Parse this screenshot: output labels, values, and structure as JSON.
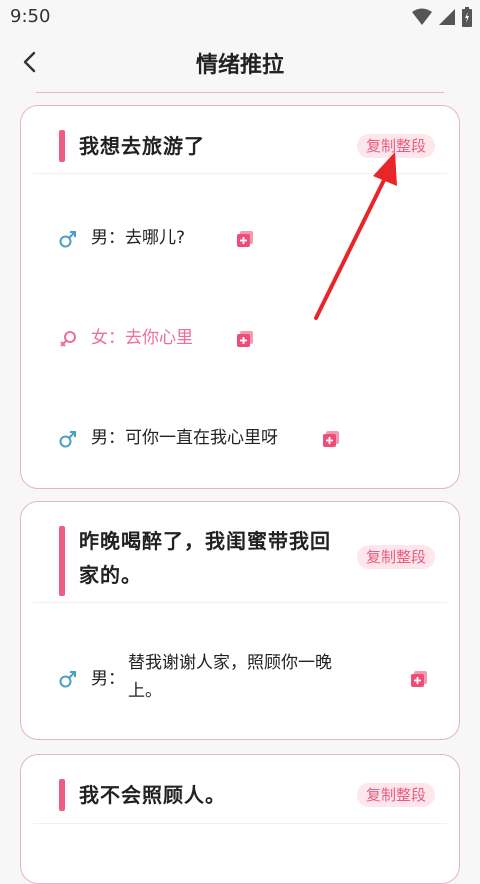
{
  "status_bar": {
    "time": "9:50",
    "icons": [
      "wifi-icon",
      "signal-icon",
      "battery-icon"
    ]
  },
  "header": {
    "title": "情绪推拉",
    "back_icon": "chevron-left-icon"
  },
  "colors": {
    "accent": "#ee5d82",
    "male": "#4a9ec7",
    "female": "#ee6f93",
    "card_border": "#e7b5c6",
    "arrow": "#e8262a"
  },
  "cards": [
    {
      "title": "我想去旅游了",
      "copy_label": "复制整段",
      "lines": [
        {
          "gender": "male",
          "speaker": "男：",
          "text": "去哪儿?"
        },
        {
          "gender": "female",
          "speaker": "女：",
          "text": "去你心里"
        },
        {
          "gender": "male",
          "speaker": "男：",
          "text": "可你一直在我心里呀"
        }
      ]
    },
    {
      "title_line1": "昨晚喝醉了，我闺蜜带我回",
      "title_line2": "家的。",
      "copy_label": "复制整段",
      "lines": [
        {
          "gender": "male",
          "speaker": "男：",
          "text_line1": "替我谢谢人家，照顾你一晚",
          "text_line2": "上。"
        }
      ]
    },
    {
      "title": "我不会照顾人。",
      "copy_label": "复制整段"
    }
  ]
}
